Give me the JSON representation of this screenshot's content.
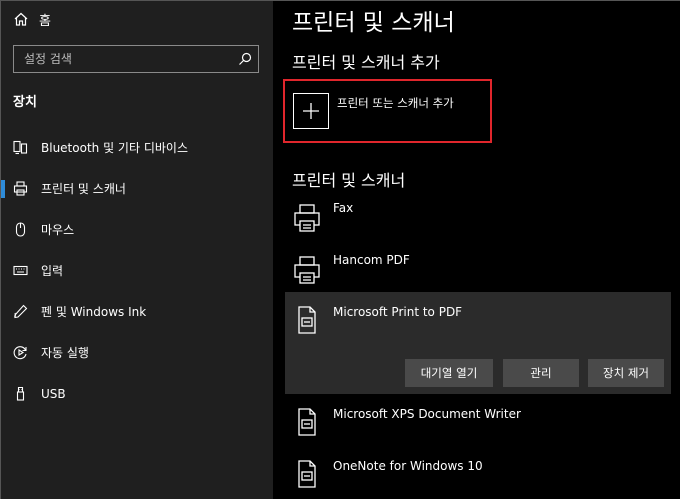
{
  "sidebar": {
    "home_label": "홈",
    "search_placeholder": "설정 검색",
    "section_title": "장치",
    "items": [
      {
        "label": "Bluetooth 및 기타 디바이스",
        "icon": "bluetooth-devices-icon"
      },
      {
        "label": "프린터 및 스캐너",
        "icon": "printer-icon",
        "active": true
      },
      {
        "label": "마우스",
        "icon": "mouse-icon"
      },
      {
        "label": "입력",
        "icon": "keyboard-icon"
      },
      {
        "label": "펜 및 Windows Ink",
        "icon": "pen-icon"
      },
      {
        "label": "자동 실행",
        "icon": "autoplay-icon"
      },
      {
        "label": "USB",
        "icon": "usb-icon"
      }
    ]
  },
  "main": {
    "title": "프린터 및 스캐너",
    "add_heading": "프린터 및 스캐너 추가",
    "add_button_label": "프린터 또는 스캐너 추가",
    "list_heading": "프린터 및 스캐너",
    "printers": [
      {
        "name": "Fax"
      },
      {
        "name": "Hancom PDF"
      },
      {
        "name": "Microsoft Print to PDF",
        "selected": true
      },
      {
        "name": "Microsoft XPS Document Writer"
      },
      {
        "name": "OneNote for Windows 10"
      }
    ],
    "actions": {
      "open_queue": "대기열 열기",
      "manage": "관리",
      "remove_device": "장치 제거"
    }
  },
  "colors": {
    "accent": "#2e8bd8",
    "highlight_box": "#e0262c",
    "sidebar_bg": "#1f1f1f",
    "main_bg": "#000000",
    "selected_bg": "#2b2b2b",
    "button_bg": "#4a4a4a"
  }
}
